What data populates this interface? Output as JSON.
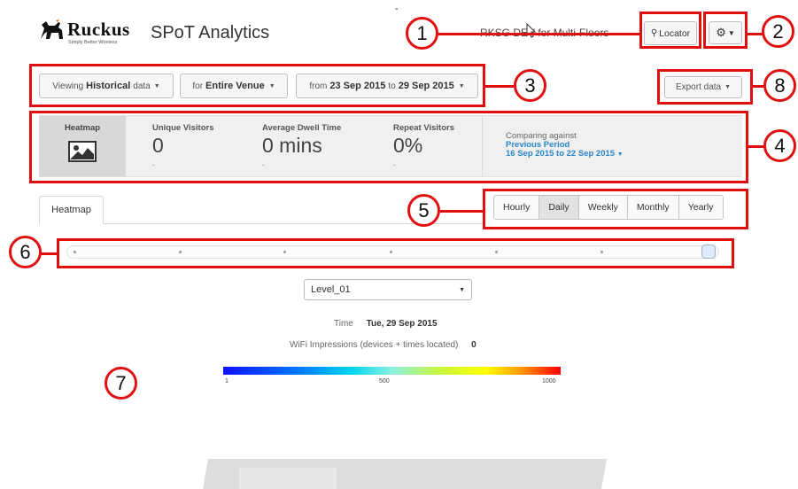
{
  "header": {
    "brand_word": "Ruckus",
    "brand_tagline": "Simply Better Wireless",
    "app_title": "SPoT Analytics",
    "venue_name": "RKSG DEV for Multi-Floors",
    "locator_label": "Locator",
    "top_mark": "-"
  },
  "filters": {
    "view_prefix": "Viewing",
    "view_value": "Historical",
    "view_suffix": "data",
    "scope_prefix": "for",
    "scope_value": "Entire Venue",
    "date_prefix": "from",
    "date_from": "23 Sep 2015",
    "date_sep": "to",
    "date_to": "29 Sep 2015",
    "export_label": "Export data"
  },
  "metrics": {
    "heatmap_label": "Heatmap",
    "unique_label": "Unique Visitors",
    "unique_value": "0",
    "unique_sub": "-",
    "dwell_label": "Average Dwell Time",
    "dwell_value": "0 mins",
    "dwell_sub": "-",
    "repeat_label": "Repeat Visitors",
    "repeat_value": "0%",
    "repeat_sub": "-",
    "compare_label": "Comparing against",
    "compare_period": "Previous Period",
    "compare_range": "16 Sep 2015 to 22 Sep 2015"
  },
  "tabs": {
    "heatmap_tab": "Heatmap"
  },
  "granularity": [
    {
      "label": "Hourly",
      "active": false
    },
    {
      "label": "Daily",
      "active": true
    },
    {
      "label": "Weekly",
      "active": false
    },
    {
      "label": "Monthly",
      "active": false
    },
    {
      "label": "Yearly",
      "active": false
    }
  ],
  "floor_select": {
    "value": "Level_01"
  },
  "time_info": {
    "label": "Time",
    "value": "Tue, 29 Sep 2015"
  },
  "wifi_info": {
    "label": "WiFi Impressions (devices + times located)",
    "value": "0"
  },
  "legend": {
    "min": "1",
    "mid": "500",
    "max": "1000"
  },
  "callouts": [
    "1",
    "2",
    "3",
    "4",
    "5",
    "6",
    "7",
    "8"
  ],
  "colors": {
    "callout_red": "#e01010",
    "link_blue": "#2a86c8"
  },
  "icons": [
    "ruckus-dog-logo",
    "map-pin-icon",
    "gear-icon",
    "caret-down-icon",
    "heatmap-image-icon",
    "mouse-pointer-icon"
  ]
}
